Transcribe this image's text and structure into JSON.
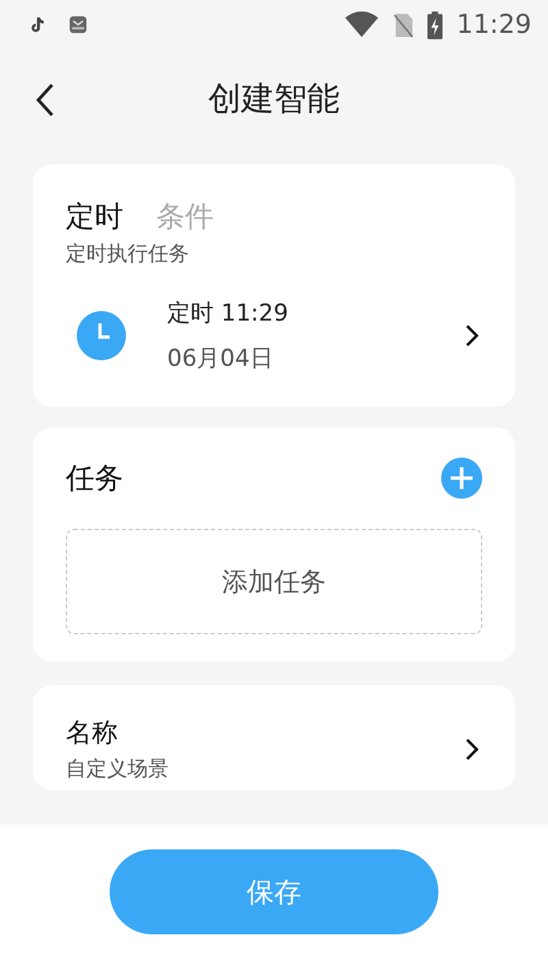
{
  "status_bar": {
    "time": "11:29"
  },
  "header": {
    "title": "创建智能"
  },
  "trigger_card": {
    "tabs": [
      {
        "label": "定时",
        "selected": true
      },
      {
        "label": "条件",
        "selected": false
      }
    ],
    "description": "定时执行任务",
    "schedule": {
      "title": "定时 11:29",
      "date": "06月04日"
    }
  },
  "task_card": {
    "title": "任务",
    "add_button": "添加任务"
  },
  "name_card": {
    "title": "名称",
    "value": "自定义场景"
  },
  "footer": {
    "save_button": "保存"
  }
}
